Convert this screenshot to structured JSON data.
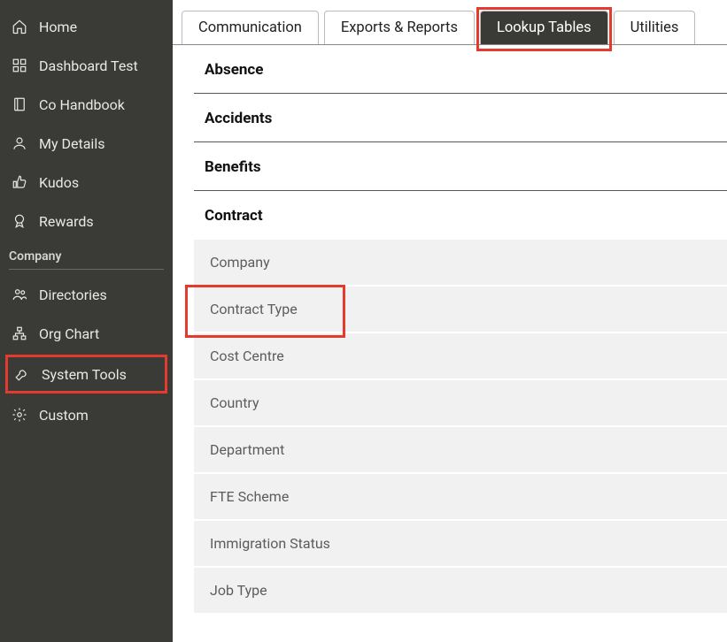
{
  "sidebar": {
    "items": [
      {
        "label": "Home"
      },
      {
        "label": "Dashboard Test"
      },
      {
        "label": "Co Handbook"
      },
      {
        "label": "My Details"
      },
      {
        "label": "Kudos"
      },
      {
        "label": "Rewards"
      }
    ],
    "group_label": "Company",
    "company_items": [
      {
        "label": "Directories"
      },
      {
        "label": "Org Chart"
      },
      {
        "label": "System Tools"
      },
      {
        "label": "Custom"
      }
    ]
  },
  "tabs": [
    {
      "label": "Communication"
    },
    {
      "label": "Exports & Reports"
    },
    {
      "label": "Lookup Tables"
    },
    {
      "label": "Utilities"
    }
  ],
  "categories": [
    {
      "label": "Absence"
    },
    {
      "label": "Accidents"
    },
    {
      "label": "Benefits"
    },
    {
      "label": "Contract"
    }
  ],
  "contract_sub": [
    {
      "label": "Company"
    },
    {
      "label": "Contract Type"
    },
    {
      "label": "Cost Centre"
    },
    {
      "label": "Country"
    },
    {
      "label": "Department"
    },
    {
      "label": "FTE Scheme"
    },
    {
      "label": "Immigration Status"
    },
    {
      "label": "Job Type"
    }
  ]
}
